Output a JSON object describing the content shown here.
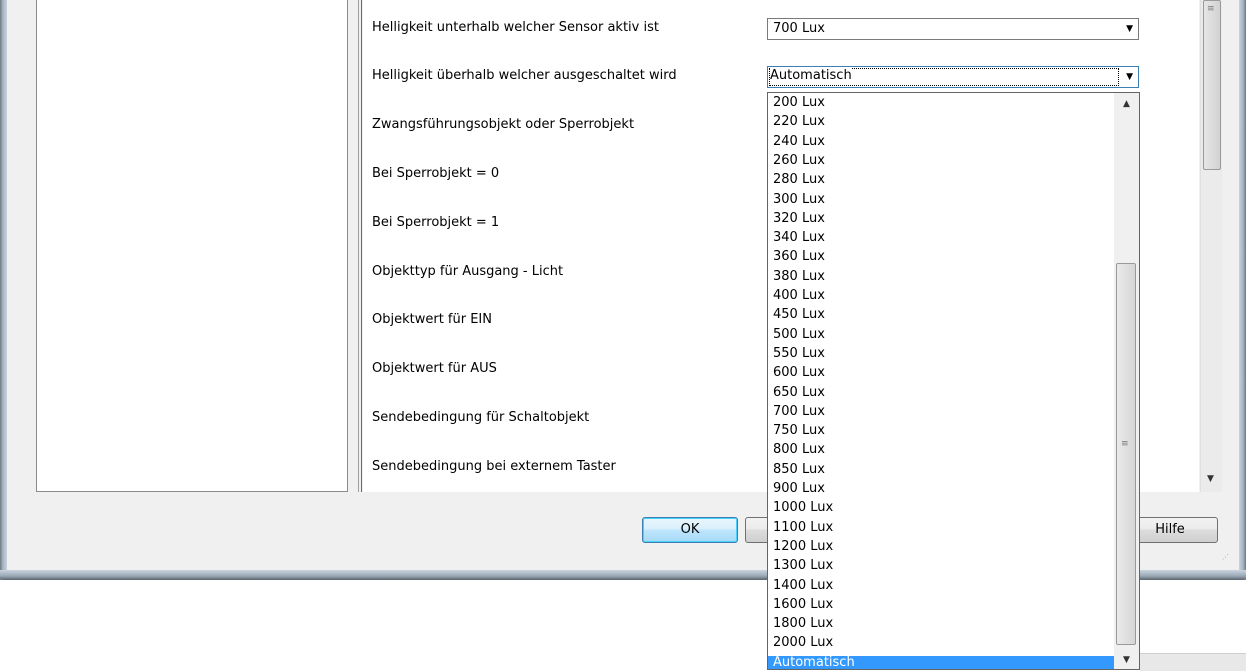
{
  "parameters": [
    {
      "label": "Helligkeit unterhalb welcher Sensor aktiv ist",
      "value": "700 Lux"
    },
    {
      "label": "Helligkeit überhalb welcher ausgeschaltet wird",
      "value": "Automatisch"
    },
    {
      "label": "Zwangsführungsobjekt oder Sperrobjekt"
    },
    {
      "label": "Bei Sperrobjekt = 0"
    },
    {
      "label": "Bei Sperrobjekt = 1"
    },
    {
      "label": "Objekttyp für Ausgang - Licht"
    },
    {
      "label": "Objektwert für EIN"
    },
    {
      "label": "Objektwert für AUS"
    },
    {
      "label": "Sendebedingung für Schaltobjekt"
    },
    {
      "label": "Sendebedingung bei externem Taster"
    }
  ],
  "dropdown": {
    "options": [
      "200 Lux",
      "220 Lux",
      "240 Lux",
      "260 Lux",
      "280 Lux",
      "300 Lux",
      "320 Lux",
      "340 Lux",
      "360 Lux",
      "380 Lux",
      "400 Lux",
      "450 Lux",
      "500 Lux",
      "550 Lux",
      "600 Lux",
      "650 Lux",
      "700 Lux",
      "750 Lux",
      "800 Lux",
      "850 Lux",
      "900 Lux",
      "1000 Lux",
      "1100 Lux",
      "1200 Lux",
      "1300 Lux",
      "1400 Lux",
      "1600 Lux",
      "1800 Lux",
      "2000 Lux",
      "Automatisch"
    ],
    "selected": "Automatisch"
  },
  "buttons": {
    "ok": "OK",
    "help": "Hilfe"
  },
  "icons": {
    "combo_arrow": "▼",
    "scroll_up": "▲",
    "scroll_down": "▼",
    "grip": "≡"
  },
  "colors": {
    "selection": "#3399ff",
    "dialog_bg": "#f0f0f0"
  }
}
